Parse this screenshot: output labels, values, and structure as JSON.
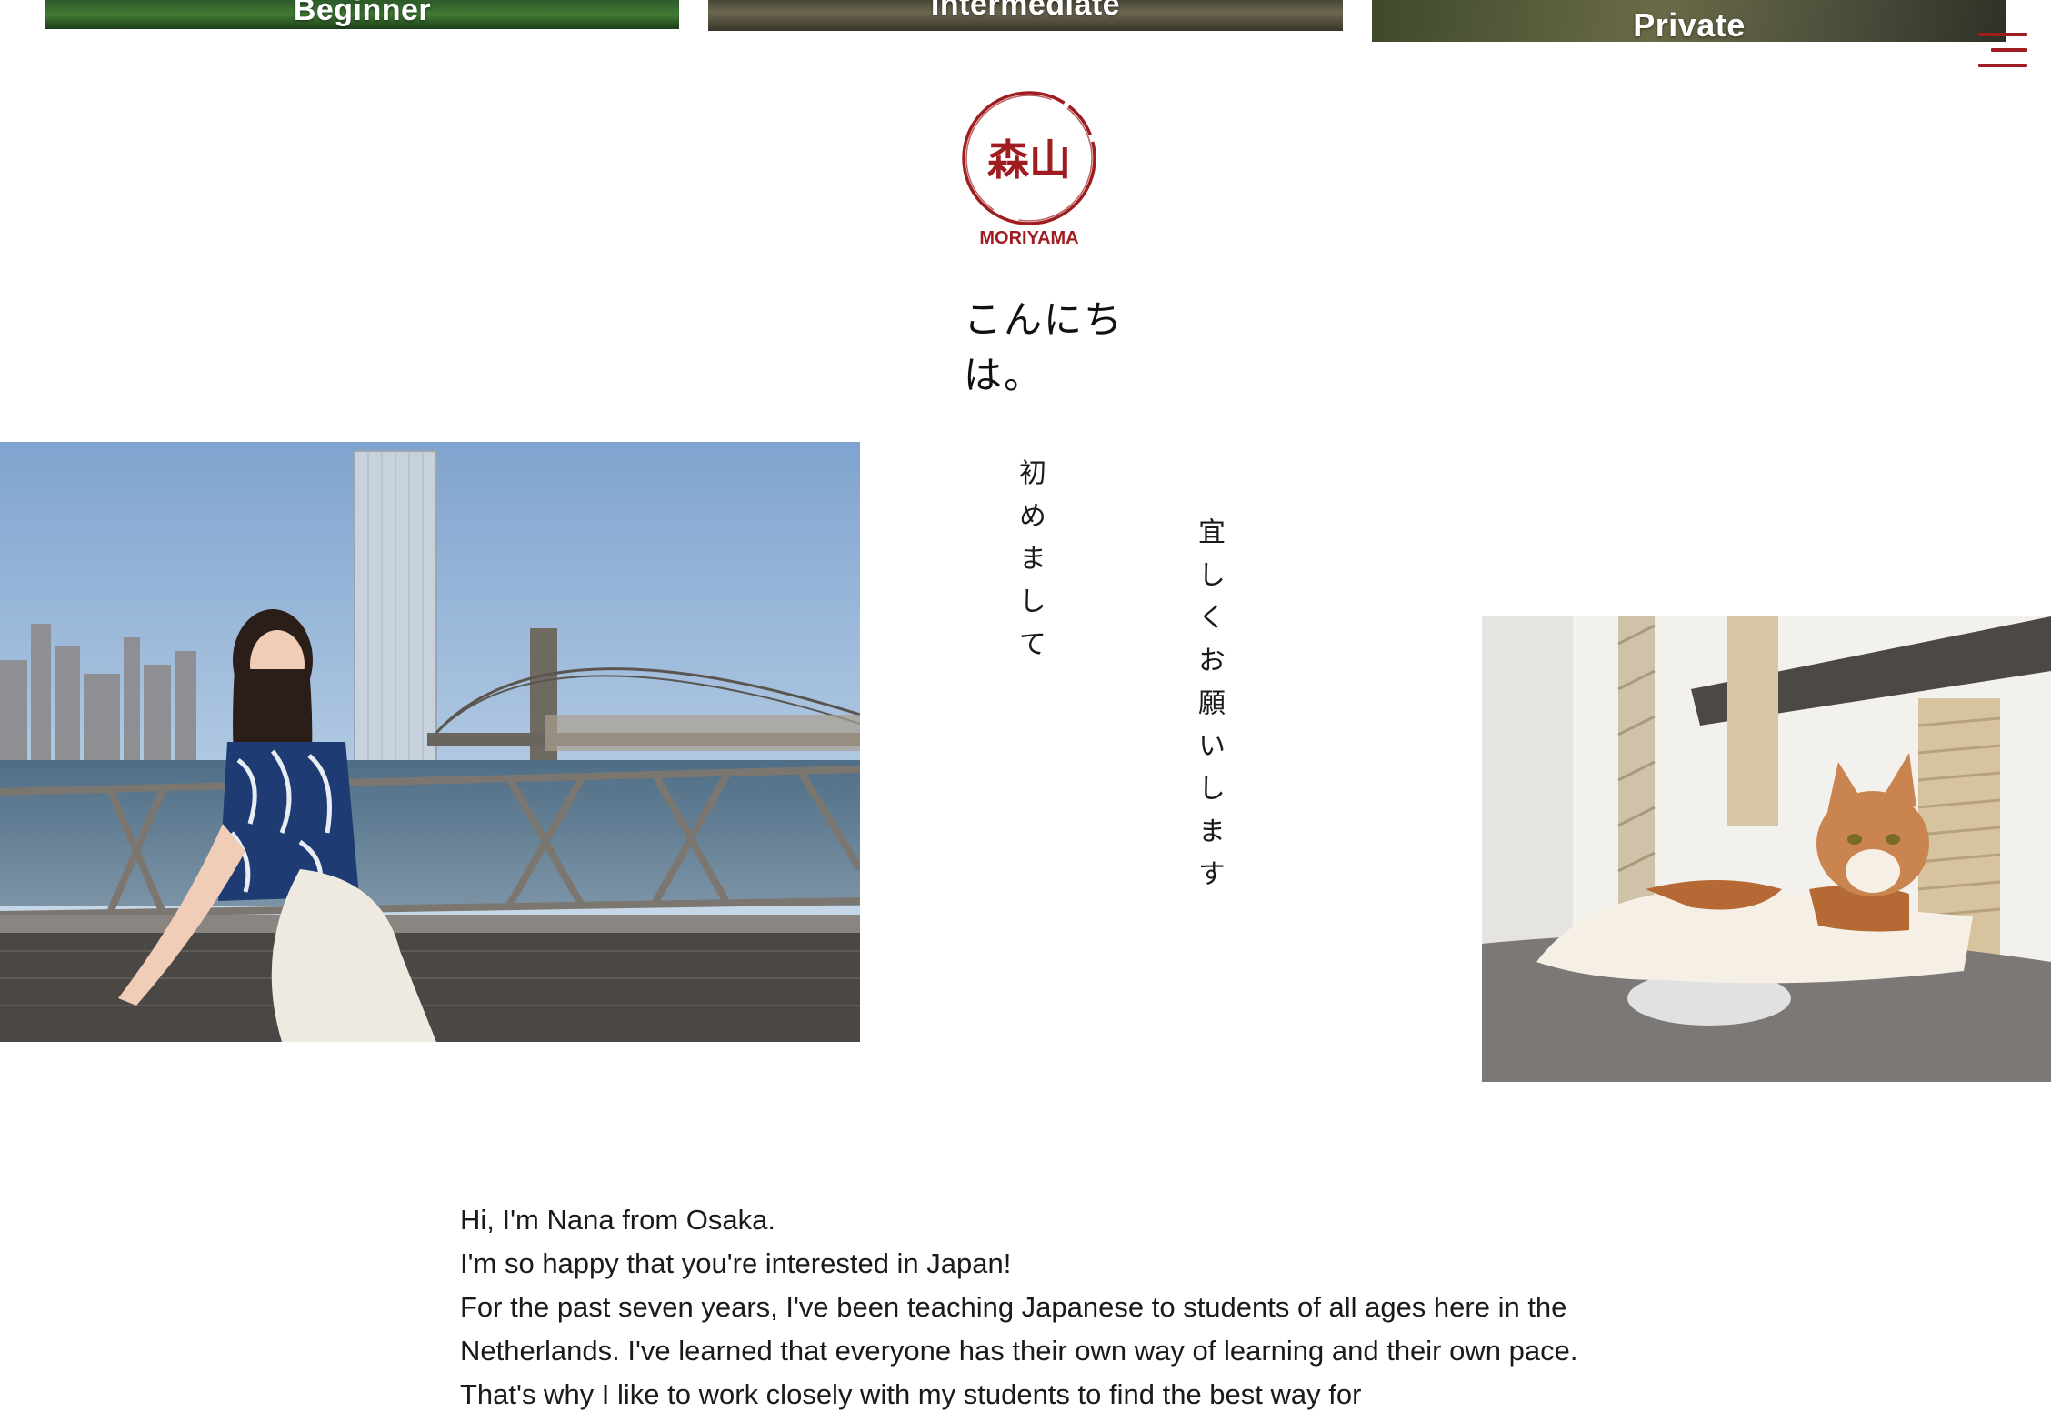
{
  "cards": [
    {
      "label": "Beginner"
    },
    {
      "label": "Intermediate"
    },
    {
      "label": "Private"
    }
  ],
  "logo": {
    "kanji": "森山",
    "name": "MORIYAMA"
  },
  "colors": {
    "brand_red": "#9f1d20",
    "text": "#1a1a1a",
    "background": "#ffffff"
  },
  "greeting": "こんにちは。",
  "vertical_text": {
    "first": "初めまして",
    "second": "宜しくお願いします"
  },
  "intro": {
    "lines": [
      "Hi, I'm Nana from Osaka.",
      "I'm so happy that you're interested in Japan!",
      "For the past seven years, I've been teaching Japanese to students of all ages here in the Netherlands. I've learned that everyone has their own way of learning and their own pace. That's why I like to work closely with my students to find the best way for"
    ]
  },
  "icons": {
    "menu": "hamburger-menu-icon"
  }
}
